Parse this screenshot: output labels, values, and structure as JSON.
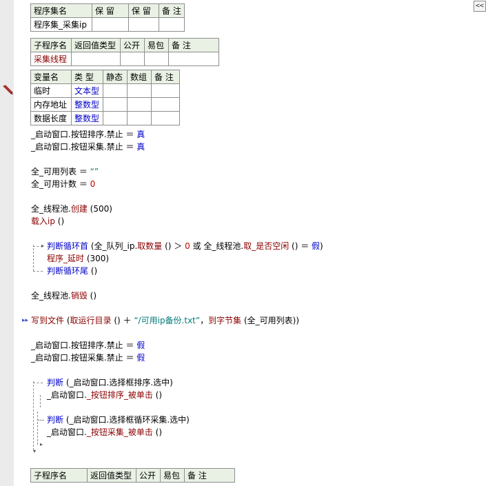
{
  "toolbar": {
    "collapse_label": "<<"
  },
  "assembly_table": {
    "headers": [
      "程序集名",
      "保 留",
      "保 留",
      "备 注"
    ],
    "row": [
      "程序集_采集ip",
      "",
      "",
      ""
    ]
  },
  "sub_table": {
    "headers": [
      "子程序名",
      "返回值类型",
      "公开",
      "易包",
      "备 注"
    ],
    "row": [
      "采集线程",
      "",
      "",
      "",
      ""
    ]
  },
  "var_table": {
    "headers": [
      "变量名",
      "类 型",
      "静态",
      "数组",
      "备 注"
    ],
    "rows": [
      [
        "临时",
        "文本型",
        "",
        "",
        ""
      ],
      [
        "内存地址",
        "整数型",
        "",
        "",
        ""
      ],
      [
        "数据长度",
        "整数型",
        "",
        "",
        ""
      ]
    ]
  },
  "code": {
    "l1": {
      "a": "_启动窗口.按钮排序.禁止 ＝ ",
      "b": "真"
    },
    "l2": {
      "a": "_启动窗口.按钮采集.禁止 ＝ ",
      "b": "真"
    },
    "l3": {
      "a": "全_可用列表 ＝ ",
      "b": "“”"
    },
    "l4": {
      "a": "全_可用计数 ＝ ",
      "b": "0"
    },
    "l5": {
      "a": "全_线程池.",
      "b": "创建",
      "c": " (500)"
    },
    "l6": {
      "a": "载入ip",
      "b": " ()"
    },
    "l7": {
      "a": "判断循环首",
      "b": " (全_队列_ip.",
      "c": "取数量",
      "d": " () ＞ ",
      "e": "0",
      "f": " 或 全_线程池.",
      "g": "取_是否空闲",
      "h": " () ＝ ",
      "i": "假",
      "j": ")"
    },
    "l8": {
      "a": "程序_延时",
      "b": " (300)"
    },
    "l9": {
      "a": "判断循环尾",
      "b": " ()"
    },
    "l10": {
      "a": "全_线程池.",
      "b": "销毁",
      "c": " ()"
    },
    "l11": {
      "a": "写到文件",
      "b": " (",
      "c": "取运行目录",
      "d": " () ＋ ",
      "e": "“/可用ip备份.txt”",
      "f": "，",
      "g": "到字节集",
      "h": " (全_可用列表))"
    },
    "l12": {
      "a": "_启动窗口.按钮排序.禁止 ＝ ",
      "b": "假"
    },
    "l13": {
      "a": "_启动窗口.按钮采集.禁止 ＝ ",
      "b": "假"
    },
    "l14": {
      "a": "判断",
      "b": " (_启动窗口.选择框排序.选中)"
    },
    "l15": {
      "a": "_启动窗口.",
      "b": "_按钮排序_被单击",
      "c": " ()"
    },
    "l16": {
      "a": "判断",
      "b": " (_启动窗口.选择框循环采集.选中)"
    },
    "l17": {
      "a": "_启动窗口.",
      "b": "_按钮采集_被单击",
      "c": " ()"
    }
  },
  "sub_table2": {
    "headers": [
      "子程序名",
      "返回值类型",
      "公开",
      "易包",
      "备 注"
    ]
  },
  "icons": {
    "breakpoint": "pencil-icon",
    "exec": "double-arrow-icon",
    "collapse": "collapse-icon"
  },
  "colors": {
    "keyword": "#0000c8",
    "method": "#8b0000",
    "string": "#007a7a",
    "number": "#c00000",
    "header_bg": "#e9f1e4",
    "gutter": "#ebebeb"
  }
}
